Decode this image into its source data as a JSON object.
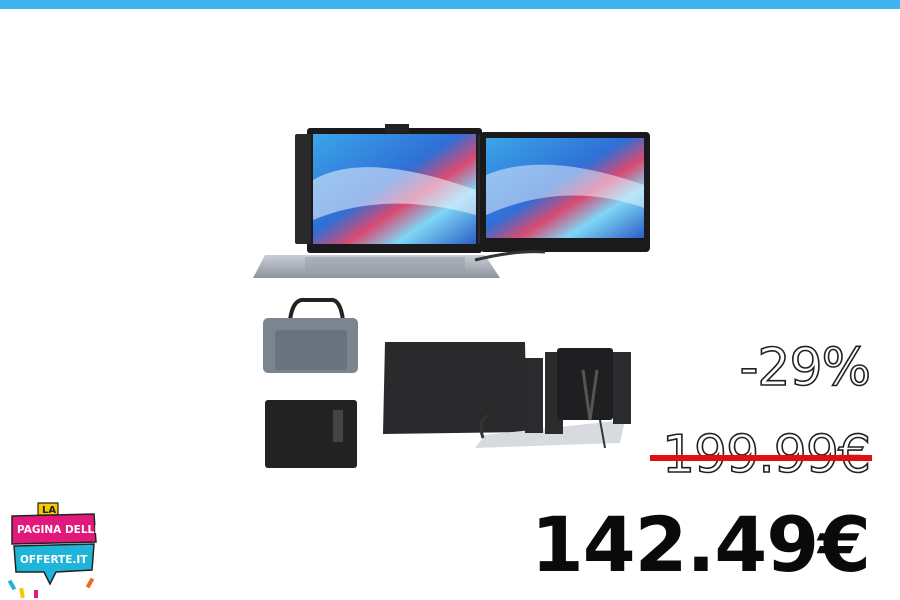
{
  "colors": {
    "accent_bar": "#3db4f2",
    "strike": "#e01010",
    "price": "#0a0a0a"
  },
  "product": {
    "image_name": "portable-triple-monitor-extender"
  },
  "pricing": {
    "discount": "-29%",
    "old_price": "199.99€",
    "new_price": "142.49€"
  },
  "logo": {
    "line1": "LA",
    "line2": "PAGINA DELLE",
    "line3": "OFFERTE.IT"
  }
}
